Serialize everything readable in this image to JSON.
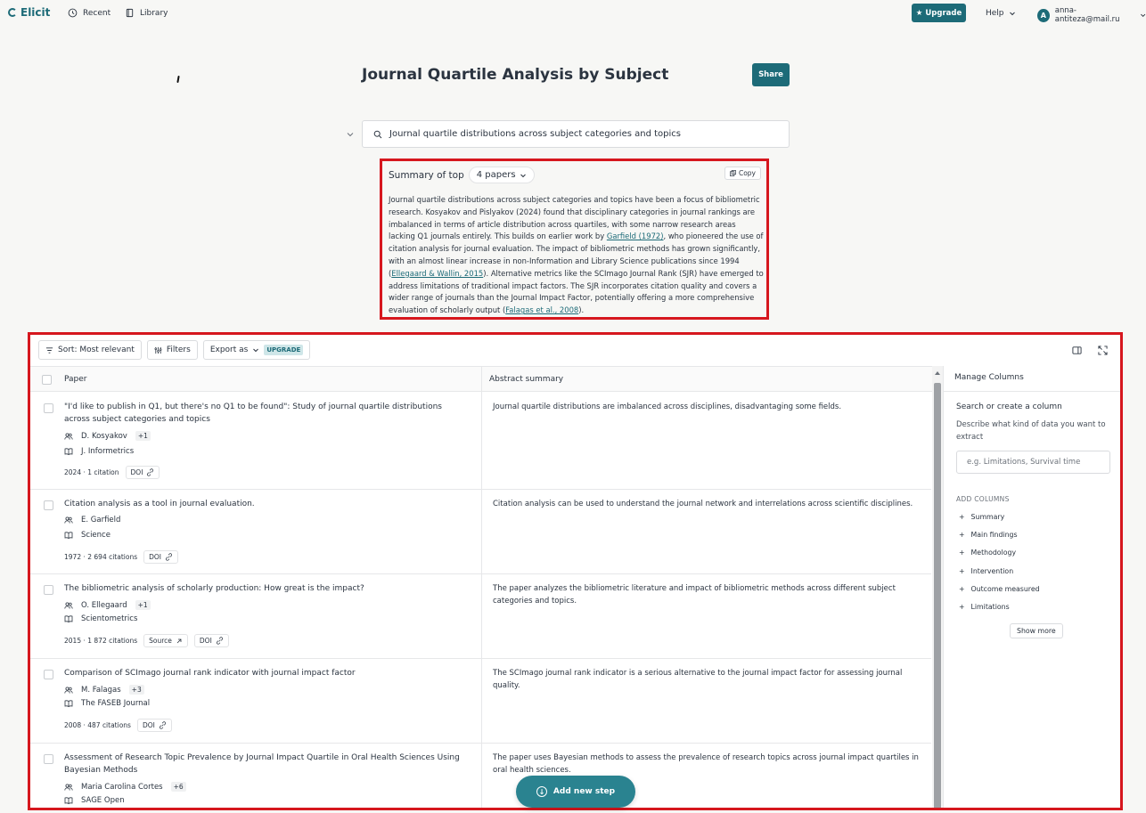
{
  "nav": {
    "logo": "Elicit",
    "recent": "Recent",
    "library": "Library",
    "upgrade": "Upgrade",
    "help": "Help",
    "user_initial": "A",
    "user_email": "anna-antiteza@mail.ru"
  },
  "page": {
    "title": "Journal Quartile Analysis by Subject",
    "share": "Share",
    "query": "Journal quartile distributions across subject categories and topics"
  },
  "summary": {
    "label": "Summary of top",
    "papers_count": "4 papers",
    "copy": "Copy",
    "text_1": "Journal quartile distributions across subject categories and topics have been a focus of bibliometric research. Kosyakov and Pislyakov (2024) found that disciplinary categories in journal rankings are imbalanced in terms of article distribution across quartiles, with some narrow research areas lacking Q1 journals entirely. This builds on earlier work by ",
    "cite_1": "Garfield (1972)",
    "text_2": ", who pioneered the use of citation analysis for journal evaluation. The impact of bibliometric methods has grown significantly, with an almost linear increase in non-Information and Library Science publications since 1994 (",
    "cite_2": "Ellegaard & Wallin, 2015",
    "text_3": "). Alternative metrics like the SCImago Journal Rank (SJR) have emerged to address limitations of traditional impact factors. The SJR incorporates citation quality and covers a wider range of journals than the Journal Impact Factor, potentially offering a more comprehensive evaluation of scholarly output (",
    "cite_3": "Falagas et al., 2008",
    "text_4": ")."
  },
  "toolbar": {
    "sort": "Sort: Most relevant",
    "filters": "Filters",
    "export": "Export as",
    "upgrade_badge": "UPGRADE"
  },
  "table": {
    "col_paper": "Paper",
    "col_abstract": "Abstract summary",
    "rows": [
      {
        "title": "\"I'd like to publish in Q1, but there's no Q1 to be found\": Study of journal quartile distributions across subject categories and topics",
        "author": "D. Kosyakov",
        "more_authors": "+1",
        "journal": "J. Informetrics",
        "stats": "2024 · 1 citation",
        "doi": "DOI",
        "abstract": "Journal quartile distributions are imbalanced across disciplines, disadvantaging some fields."
      },
      {
        "title": "Citation analysis as a tool in journal evaluation.",
        "author": "E. Garfield",
        "more_authors": "",
        "journal": "Science",
        "stats": "1972 · 2 694 citations",
        "doi": "DOI",
        "abstract": "Citation analysis can be used to understand the journal network and interrelations across scientific disciplines."
      },
      {
        "title": "The bibliometric analysis of scholarly production: How great is the impact?",
        "author": "O. Ellegaard",
        "more_authors": "+1",
        "journal": "Scientometrics",
        "stats": "2015 · 1 872 citations",
        "source": "Source",
        "doi": "DOI",
        "abstract": "The paper analyzes the bibliometric literature and impact of bibliometric methods across different subject categories and topics."
      },
      {
        "title": "Comparison of SCImago journal rank indicator with journal impact factor",
        "author": "M. Falagas",
        "more_authors": "+3",
        "journal": "The FASEB Journal",
        "stats": "2008 · 487 citations",
        "doi": "DOI",
        "abstract": "The SCImago journal rank indicator is a serious alternative to the journal impact factor for assessing journal quality."
      },
      {
        "title": "Assessment of Research Topic Prevalence by Journal Impact Quartile in Oral Health Sciences Using Bayesian Methods",
        "author": "Maria Carolina Cortes",
        "more_authors": "+6",
        "journal": "SAGE Open",
        "abstract": "The paper uses Bayesian methods to assess the prevalence of research topics across journal impact quartiles in oral health sciences."
      }
    ]
  },
  "side": {
    "title": "Manage Columns",
    "subtitle": "Search or create a column",
    "description": "Describe what kind of data you want to extract",
    "input_placeholder": "e.g. Limitations, Survival time",
    "add_columns": "ADD COLUMNS",
    "columns": [
      "Summary",
      "Main findings",
      "Methodology",
      "Intervention",
      "Outcome measured",
      "Limitations"
    ],
    "show_more": "Show more"
  },
  "add_step": "Add new step",
  "colors": {
    "accent": "#1d6b78",
    "highlight_border": "#d6171e"
  }
}
